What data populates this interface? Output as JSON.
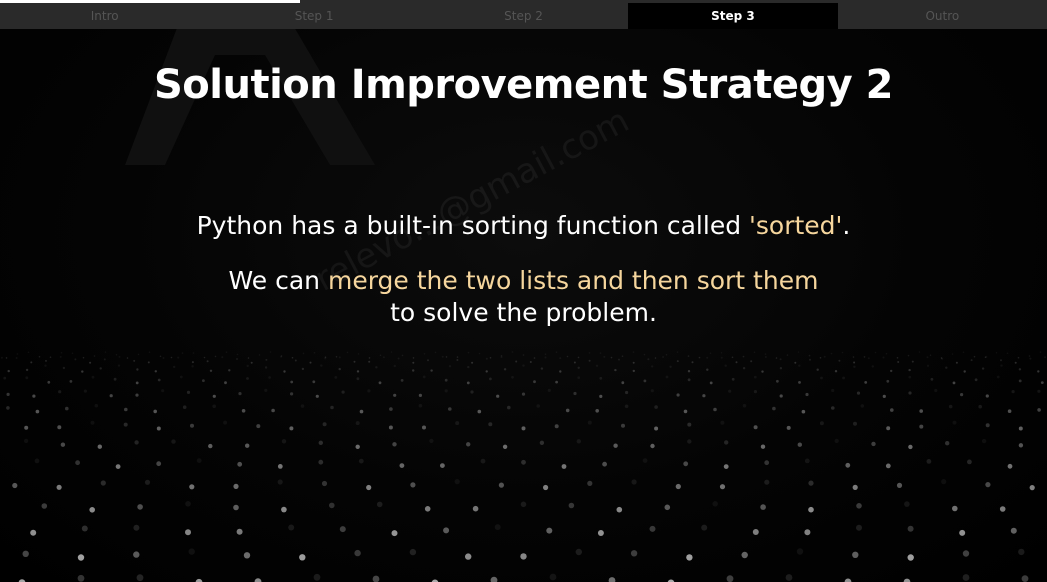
{
  "progress": {
    "fraction": 0.287
  },
  "tabs": [
    {
      "label": "Intro",
      "active": false
    },
    {
      "label": "Step 1",
      "active": false
    },
    {
      "label": "Step 2",
      "active": false
    },
    {
      "label": "Step 3",
      "active": true
    },
    {
      "label": "Outro",
      "active": false
    }
  ],
  "slide": {
    "title": "Solution Improvement Strategy 2",
    "line1": {
      "before": "Python has a built-in sorting function called ",
      "highlight": "'sorted'",
      "after": "."
    },
    "line2": {
      "before": "We can ",
      "highlight": "merge the two lists and then sort them"
    },
    "line3": "to solve the problem.",
    "watermark": "relevo...@gmail.com"
  },
  "colors": {
    "background": "#000000",
    "text": "#ffffff",
    "highlight": "#f6d69d",
    "tab_inactive_bg": "#2a2a2a",
    "tab_inactive_text": "#555555",
    "tab_active_bg": "#000000"
  }
}
